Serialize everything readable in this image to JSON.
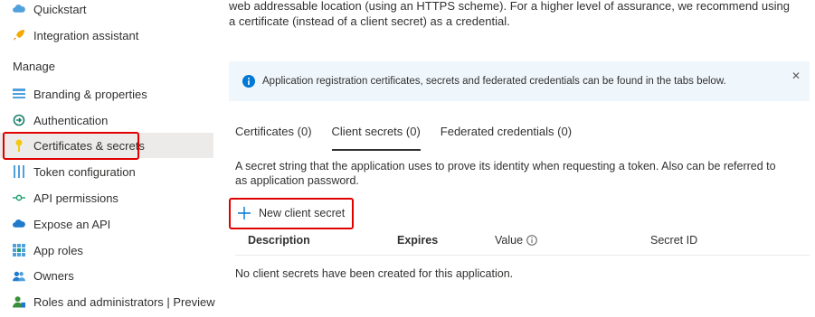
{
  "sidebar": {
    "items_top": [
      {
        "label": "Quickstart",
        "icon": "cloud-icon"
      },
      {
        "label": "Integration assistant",
        "icon": "rocket-icon"
      }
    ],
    "section_label": "Manage",
    "items": [
      {
        "label": "Branding & properties",
        "icon": "branding-icon"
      },
      {
        "label": "Authentication",
        "icon": "authentication-icon"
      },
      {
        "label": "Certificates & secrets",
        "icon": "key-icon"
      },
      {
        "label": "Token configuration",
        "icon": "token-icon"
      },
      {
        "label": "API permissions",
        "icon": "permissions-icon"
      },
      {
        "label": "Expose an API",
        "icon": "cloud-api-icon"
      },
      {
        "label": "App roles",
        "icon": "app-roles-icon"
      },
      {
        "label": "Owners",
        "icon": "owners-icon"
      },
      {
        "label": "Roles and administrators | Preview",
        "icon": "roles-admin-icon"
      }
    ]
  },
  "main": {
    "intro": "web addressable location (using an HTTPS scheme). For a higher level of assurance, we recommend using a certificate (instead of a client secret) as a credential.",
    "info_bar": {
      "message": "Application registration certificates, secrets and federated credentials can be found in the tabs below.",
      "close_glyph": "✕"
    },
    "tabs": [
      {
        "label": "Certificates (0)"
      },
      {
        "label": "Client secrets (0)"
      },
      {
        "label": "Federated credentials (0)"
      }
    ],
    "active_tab": "Client secrets (0)",
    "description": "A secret string that the application uses to prove its identity when requesting a token. Also can be referred to as application password.",
    "new_button_label": "New client secret",
    "table": {
      "columns": [
        "Description",
        "Expires",
        "Value",
        "Secret ID"
      ],
      "empty_message": "No client secrets have been created for this application."
    }
  },
  "colors": {
    "highlight_border": "#e00000",
    "info_background": "#eff6fc",
    "info_icon": "#0078d4",
    "selected_nav": "#edebe9"
  }
}
